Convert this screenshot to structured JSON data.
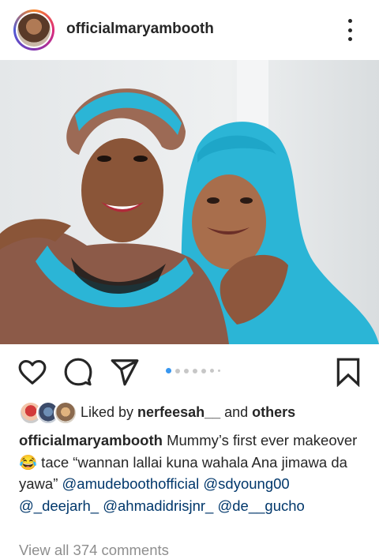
{
  "header": {
    "username": "officialmaryambooth",
    "more_icon": "more-vertical-icon"
  },
  "post": {
    "image_alt": "Two women smiling in blue headwraps",
    "carousel": {
      "current": 1,
      "total": 7
    }
  },
  "actions": {
    "like_icon": "heart-icon",
    "comment_icon": "comment-icon",
    "share_icon": "send-icon",
    "save_icon": "bookmark-icon"
  },
  "likes": {
    "prefix": "Liked by ",
    "user": "nerfeesah__",
    "conjunction": " and ",
    "others": "others"
  },
  "caption": {
    "username": "officialmaryambooth",
    "text_1": " Mummy’s first ever makeover ",
    "emoji": "😂",
    "text_2": " tace “wannan lallai kuna wahala Ana jimawa da yawa” ",
    "mentions": [
      "@amudeboothofficial",
      "@sdyoung00",
      "@_deejarh_",
      "@ahmadidrisjnr_",
      "@de__gucho"
    ]
  },
  "comments": {
    "view_all": "View all 374 comments"
  },
  "colors": {
    "accent": "#3897f0",
    "link": "#00376b",
    "muted": "#8e8e8e",
    "text": "#262626"
  }
}
